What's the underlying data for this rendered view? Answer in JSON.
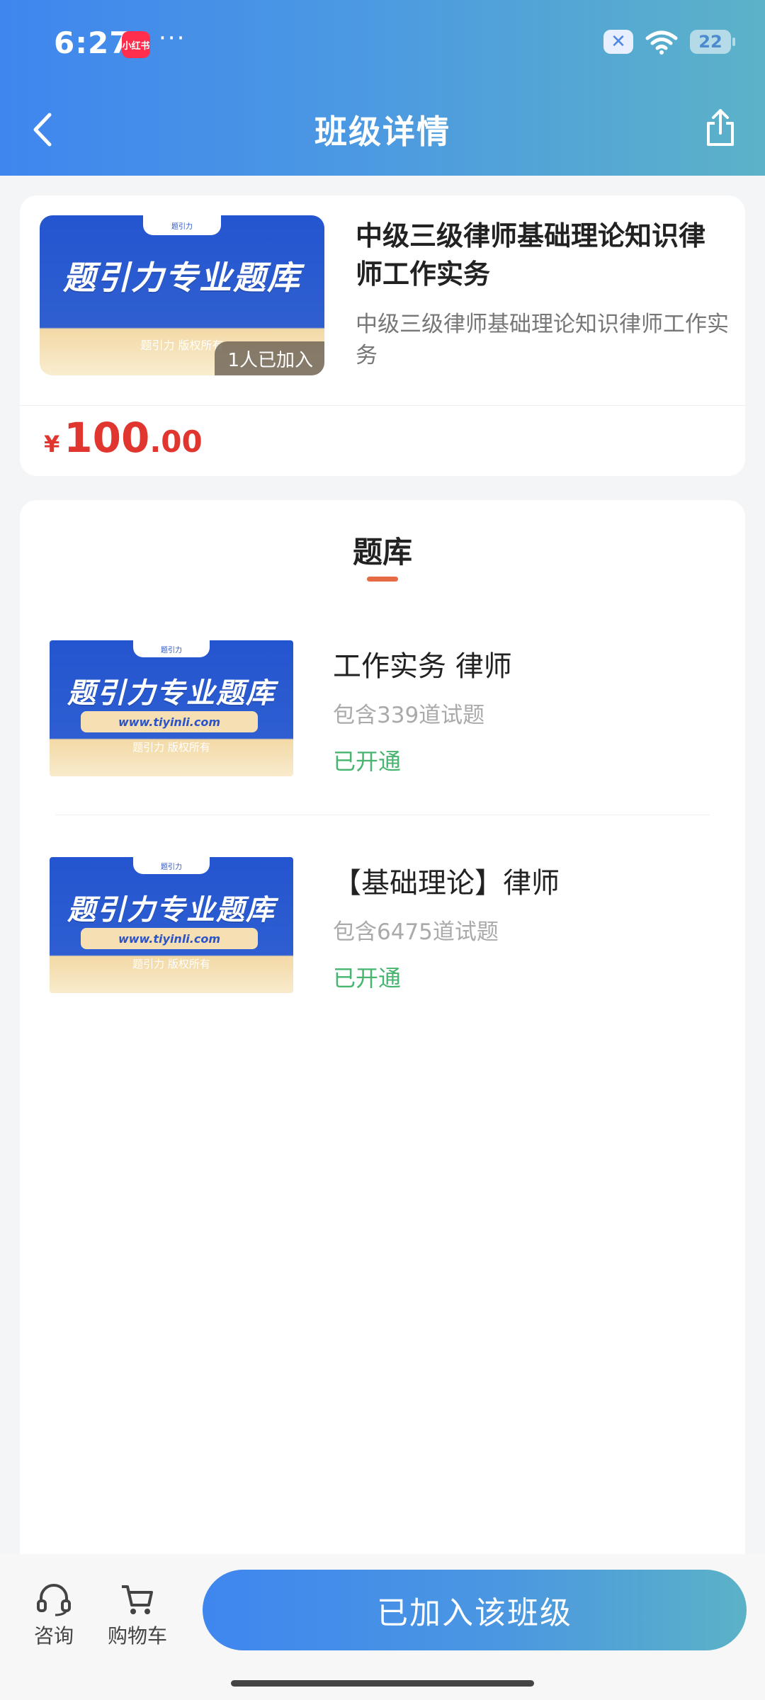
{
  "status_bar": {
    "time": "6:27",
    "app_badge": "小红书",
    "dots": "···",
    "battery": "22"
  },
  "nav": {
    "title": "班级详情"
  },
  "class_info": {
    "thumb_title": "题引力专业题库",
    "thumb_tab": "题引力",
    "thumb_sub": "题引力 版权所有",
    "joined": "1人已加入",
    "title": "中级三级律师基础理论知识律师工作实务",
    "desc": "中级三级律师基础理论知识律师工作实务",
    "price_symbol": "¥",
    "price_int": "100",
    "price_dec": ".00"
  },
  "bank": {
    "section_title": "题库",
    "items": [
      {
        "thumb_title": "题引力专业题库",
        "thumb_tab": "题引力",
        "thumb_url": "www.tiyinli.com",
        "thumb_sub": "题引力 版权所有",
        "name": "工作实务 律师",
        "count": "包含339道试题",
        "status": "已开通"
      },
      {
        "thumb_title": "题引力专业题库",
        "thumb_tab": "题引力",
        "thumb_url": "www.tiyinli.com",
        "thumb_sub": "题引力 版权所有",
        "name": "【基础理论】律师",
        "count": "包含6475道试题",
        "status": "已开通"
      }
    ]
  },
  "bottom": {
    "consult": "咨询",
    "cart": "购物车",
    "join_button": "已加入该班级"
  }
}
